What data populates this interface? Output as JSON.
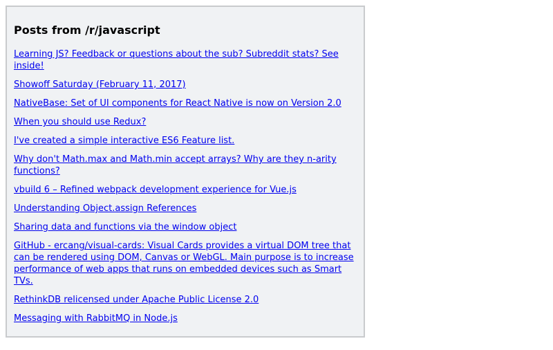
{
  "panel": {
    "title": "Posts from /r/javascript",
    "colors": {
      "background": "#f0f2f4",
      "border": "#c9cbcd",
      "link": "#0000ee"
    },
    "posts": [
      {
        "label": "Learning JS? Feedback or questions about the sub? Subreddit stats? See inside!"
      },
      {
        "label": "Showoff Saturday (February 11, 2017)"
      },
      {
        "label": "NativeBase: Set of UI components for React Native is now on Version 2.0"
      },
      {
        "label": "When you should use Redux?"
      },
      {
        "label": "I've created a simple interactive ES6 Feature list."
      },
      {
        "label": "Why don't Math.max and Math.min accept arrays? Why are they n-arity functions?"
      },
      {
        "label": "vbuild 6 – Refined webpack development experience for Vue.js"
      },
      {
        "label": "Understanding Object.assign References"
      },
      {
        "label": "Sharing data and functions via the window object"
      },
      {
        "label": "GitHub - ercang/visual-cards: Visual Cards provides a virtual DOM tree that can be rendered using DOM, Canvas or WebGL. Main purpose is to increase performance of web apps that runs on embedded devices such as Smart TVs."
      },
      {
        "label": "RethinkDB relicensed under Apache Public License 2.0"
      },
      {
        "label": "Messaging with RabbitMQ in Node.js"
      }
    ]
  }
}
